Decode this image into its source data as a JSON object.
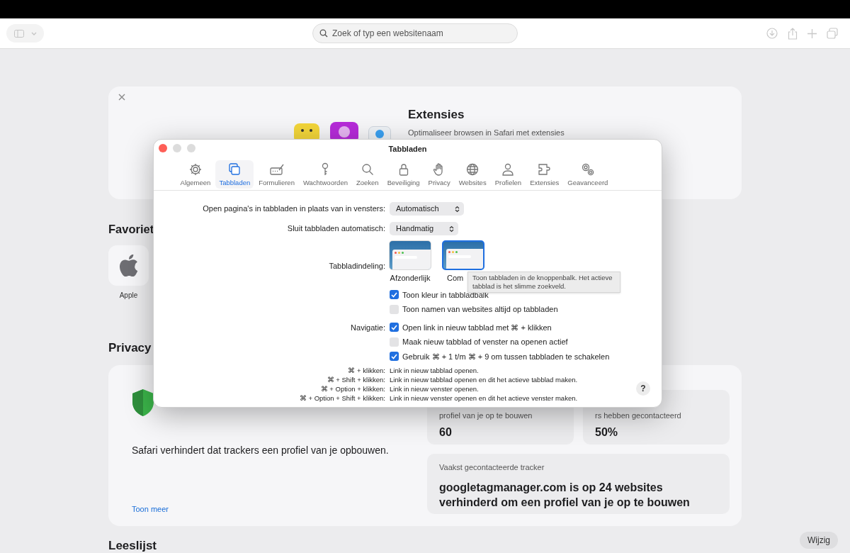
{
  "browser_toolbar": {
    "search_placeholder": "Zoek of typ een websitenaam"
  },
  "extensions_card": {
    "title": "Extensies",
    "description": "Optimaliseer browsen in Safari met extensies"
  },
  "favorites": {
    "heading": "Favoriet",
    "items": [
      {
        "label": "Apple"
      }
    ]
  },
  "privacy": {
    "heading": "Privacy",
    "summary": "Safari verhindert dat trackers een profiel van je opbouwen.",
    "link": "Toon meer",
    "stats": [
      {
        "label": "profiel van je op te bouwen",
        "value": "60"
      },
      {
        "label": "rs hebben gecontacteerd",
        "value": "50%"
      }
    ],
    "tracker": {
      "label": "Vaakst gecontacteerde tracker",
      "text": "googletagmanager.com is op 24 websites verhinderd om een profiel van je op te bouwen"
    }
  },
  "edit_button": "Wijzig",
  "reading_list": {
    "heading": "Leeslijst"
  },
  "dialog": {
    "title": "Tabbladen",
    "tabs": [
      {
        "label": "Algemeen",
        "selected": false
      },
      {
        "label": "Tabbladen",
        "selected": true
      },
      {
        "label": "Formulieren",
        "selected": false
      },
      {
        "label": "Wachtwoorden",
        "selected": false
      },
      {
        "label": "Zoeken",
        "selected": false
      },
      {
        "label": "Beveiliging",
        "selected": false
      },
      {
        "label": "Privacy",
        "selected": false
      },
      {
        "label": "Websites",
        "selected": false
      },
      {
        "label": "Profielen",
        "selected": false
      },
      {
        "label": "Extensies",
        "selected": false
      },
      {
        "label": "Geavanceerd",
        "selected": false
      }
    ],
    "popups": [
      {
        "label": "Open pagina's in tabbladen in plaats van in vensters:",
        "value": "Automatisch"
      },
      {
        "label": "Sluit tabbladen automatisch:",
        "value": "Handmatig"
      }
    ],
    "layout": {
      "label": "Tabbladindeling:",
      "options": [
        {
          "label": "Afzonderlijk",
          "selected": false
        },
        {
          "label": "Com",
          "selected": true
        }
      ],
      "tooltip": "Toon tabbladen in de knoppenbalk. Het actieve tabblad is het slimme zoekveld.",
      "checkboxes": [
        {
          "label": "Toon kleur in tabbladbalk",
          "checked": true
        },
        {
          "label": "Toon namen van websites altijd op tabbladen",
          "checked": false
        }
      ]
    },
    "navigation": {
      "label": "Navigatie:",
      "checkboxes": [
        {
          "label": "Open link in nieuw tabblad met ⌘ + klikken",
          "checked": true
        },
        {
          "label": "Maak nieuw tabblad of venster na openen actief",
          "checked": false
        },
        {
          "label": "Gebruik ⌘ + 1 t/m ⌘ + 9 om tussen tabbladen te schakelen",
          "checked": true
        }
      ]
    },
    "shortcuts": [
      {
        "keys": "⌘ + klikken:",
        "description": "Link in nieuw tabblad openen."
      },
      {
        "keys": "⌘ + Shift + klikken:",
        "description": "Link in nieuw tabblad openen en dit het actieve tabblad maken."
      },
      {
        "keys": "⌘ + Option + klikken:",
        "description": "Link in nieuw venster openen."
      },
      {
        "keys": "⌘ + Option + Shift + klikken:",
        "description": "Link in nieuw venster openen en dit het actieve venster maken."
      }
    ],
    "help_button": "?"
  }
}
